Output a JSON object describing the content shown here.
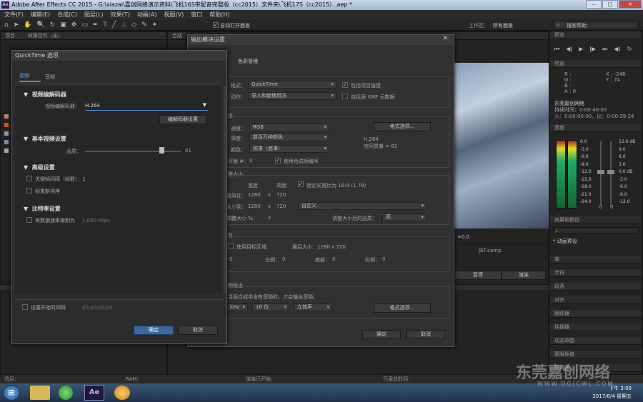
{
  "window": {
    "title": "Adobe After Effects CC 2015 - G:\\xiazai\\嘉创网络演示资料\\飞机16S带配音完整版（cc2015）文件夹\\飞机17S（cc2015）.aep *",
    "close": "✕"
  },
  "menu": [
    "文件(F)",
    "编辑(E)",
    "合成(C)",
    "图层(L)",
    "效果(T)",
    "动画(A)",
    "视图(V)",
    "窗口",
    "帮助(H)"
  ],
  "toolbar": {
    "auto_open": "自动打开面板",
    "workspace_label": "工作区：",
    "workspace_value": "所有面板",
    "search": "搜索帮助"
  },
  "left_panels": {
    "project_tab": "项目",
    "effects_tab": "效果控件（无）",
    "comp_tab": "合成",
    "output_label": "输出"
  },
  "quicktime": {
    "title": "QuickTime 选项",
    "tab_video": "视频",
    "tab_audio": "音频",
    "codec_section": "视频编解码器",
    "codec_label": "视频编解码器：",
    "codec_value": "H.264",
    "codec_settings": "编解码器设置",
    "basic_section": "基本视频设置",
    "quality_label": "品质：",
    "quality_value": "81",
    "advanced_section": "高级设置",
    "keyframe_label": "关键帧间隔（帧数）：1",
    "reorder_label": "帧重新排序",
    "bitrate_section": "比特率设置",
    "bitrate_label": "将数据速率限制为",
    "bitrate_value": "1,000 kbps",
    "start_timecode": "设置开始时间码",
    "timecode": "00;00;00;00",
    "ok": "确定",
    "cancel": "取消"
  },
  "output_module": {
    "title": "输出模块设置",
    "tab_color": "色彩管理",
    "format_label": "格式：",
    "format_value": "QuickTime",
    "include_project": "包括项目链接",
    "post_label": "动作：",
    "post_value": "导入和替换用法",
    "include_xmp": "包括源 XMP 元数据",
    "output_section": "出",
    "channels_label": "通道：",
    "channels_value": "RGB",
    "format_options": "格式选项...",
    "depth_label": "深度：",
    "depth_value": "数百万种颜色",
    "codec_info": "H.264",
    "space_info": "空间质量 = 81",
    "color_label": "颜色：",
    "color_value": "预乘（遮罩）",
    "start_label": "开始 #：",
    "start_value": "0",
    "use_comp_frame": "使用合成帧编号",
    "resize_section": "整大小",
    "width_hdr": "宽度",
    "height_hdr": "高度",
    "lock_aspect": "锁定长宽比为 16:9 (1.78)",
    "render_at": "渲染在：",
    "render_w": "1280",
    "x": "x",
    "render_h": "720",
    "resize_to": "大小到：",
    "resize_w": "1280",
    "resize_h": "720",
    "custom": "自定义",
    "resize_pct": "调整大小 %：",
    "resize_quality_label": "调整大小后的品质：",
    "resize_quality_value": "高",
    "crop_section": "剪",
    "use_roi": "使用目标区域",
    "final_size": "最后大小：1280 x 720",
    "top_label": "顶部：",
    "top": "0",
    "left_label": "左侧：",
    "left": "0",
    "bottom_label": "底部：",
    "bottom": "0",
    "right_label": "右侧：",
    "right": "0",
    "audio_section": "频输出",
    "audio_hint": "当源合成中含有音频时，才会输出音频。",
    "sample_rate": "kHz",
    "bits": "16 位",
    "stereo": "立体声",
    "audio_format_options": "格式选项...",
    "ok": "确定",
    "cancel": "取消"
  },
  "right_panels": {
    "info_tab": "信息",
    "r": "R :",
    "g": "G :",
    "b": "B :",
    "a": "A : 0",
    "xcoord": "X : -246",
    "ycoord": "Y : 74",
    "comp_name": "东莞嘉创网络",
    "duration": "持续时间：0:00:40:00",
    "inout": "入：0:00:00:00，出：0:00:39:24",
    "audio_tab": "音频",
    "db_levels": [
      "12.0 dB",
      "9.0",
      "6.0",
      "3.0",
      "0.0 dB",
      "-3.0",
      "-6.0",
      "-9.0",
      "-12.0"
    ],
    "meter_left": [
      "0.0",
      "-3.0",
      "-6.0",
      "-9.0",
      "-12.0",
      "-15.0",
      "-18.0",
      "-21.0",
      "-24.0"
    ],
    "zero1": "0",
    "zero2": "0",
    "effects_tab": "效果和预设",
    "anim_preset": "* 动画预设",
    "list": [
      "库",
      "字符",
      "段落",
      "对齐",
      "跟踪器",
      "摇摆器",
      "动态草图",
      "蒙版插值",
      "平滑器"
    ]
  },
  "timeline": {
    "comp_name": "JET.comp",
    "plus": "+0.0",
    "pause": "暂停",
    "render": "渲染"
  },
  "status": {
    "message": "消息：",
    "ram": "RAM：",
    "render_started": "渲染已开始：",
    "elapsed": "已用总时间："
  },
  "taskbar": {
    "app": "Ae",
    "time": "下午 3:09",
    "date": "2017/8/4 星期五"
  },
  "watermark": "东莞嘉创网络",
  "watermark_url": "WWW.DGJCWL.COM"
}
